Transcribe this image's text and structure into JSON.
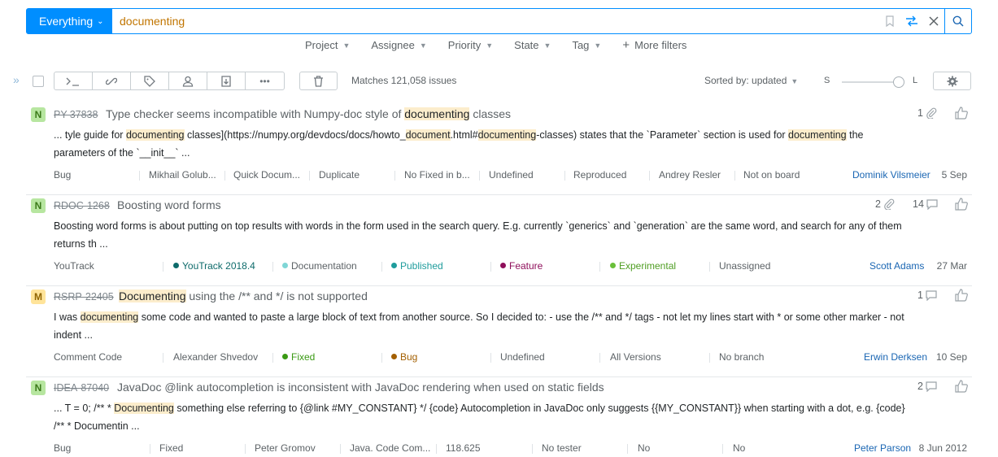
{
  "search": {
    "context": "Everything",
    "query": "documenting"
  },
  "filters": [
    "Project",
    "Assignee",
    "Priority",
    "State",
    "Tag"
  ],
  "more_filters": "More filters",
  "toolbar": {
    "matches": "Matches 121,058 issues",
    "sorted_by": "Sorted by: updated",
    "size_small": "S",
    "size_large": "L"
  },
  "issues": [
    {
      "priority": "N",
      "id": "PY-37838",
      "summary_pre": "Type checker seems incompatible with Numpy-doc style of ",
      "summary_hl": "documenting",
      "summary_post": " classes",
      "desc_parts": [
        "... tyle guide for ",
        "documenting",
        " classes](https://numpy.org/devdocs/docs/howto_",
        "document",
        ".html#",
        "documenting",
        "-classes) states that the `Parameter` section is used for ",
        "documenting",
        " the parameters of the `__init__` ..."
      ],
      "fields": [
        "Bug",
        "Mikhail Golub...",
        "Quick Docum...",
        "Duplicate",
        "No Fixed in b...",
        "Undefined",
        "Reproduced",
        "Andrey Resler",
        "Not on board"
      ],
      "assignee": "Dominik Vilsmeier",
      "date": "5 Sep",
      "attachments": "1",
      "comments": ""
    },
    {
      "priority": "N",
      "id": "RDOC-1268",
      "summary_pre": "Boosting word forms",
      "summary_hl": "",
      "summary_post": "",
      "desc_parts": [
        "Boosting word forms is about putting on top results with words in the form used in the search query. E.g. currently `generics` and `generation` are the same word, and search for any of them returns th ..."
      ],
      "fields": [
        "YouTrack",
        "YouTrack 2018.4",
        "Documentation",
        "Published",
        "Feature",
        "Experimental",
        "Unassigned"
      ],
      "field_colors": [
        "",
        "#0e6b6b",
        "#7fd6d6",
        "#1f9c9c",
        "#8f0f5b",
        "#6abf3a",
        ""
      ],
      "field_text_colors": [
        "",
        "#0e6b6b",
        "",
        "#1f9c9c",
        "#8f0f5b",
        "#4f9e23",
        ""
      ],
      "assignee": "Scott Adams",
      "date": "27 Mar",
      "attachments": "2",
      "comments": "14"
    },
    {
      "priority": "M",
      "id": "RSRP-22405",
      "summary_pre": "",
      "summary_hl": "Documenting",
      "summary_post": " using the /** and */ is not supported",
      "desc_parts": [
        "I was ",
        "documenting",
        " some code and wanted to paste a large block of text from another source. So I decided to: - use the /** and */ tags - not let my lines start with * or some other marker - not indent ..."
      ],
      "fields": [
        "Comment Code",
        "Alexander Shvedov",
        "Fixed",
        "Bug",
        "Undefined",
        "All Versions",
        "No branch"
      ],
      "field_colors": [
        "",
        "",
        "#3a9a14",
        "#a35f00",
        "",
        "",
        ""
      ],
      "field_text_colors": [
        "",
        "",
        "#3a9a14",
        "#a35f00",
        "",
        "",
        ""
      ],
      "assignee": "Erwin Derksen",
      "date": "10 Sep",
      "attachments": "",
      "comments": "1"
    },
    {
      "priority": "N",
      "id": "IDEA-87040",
      "summary_pre": "JavaDoc @link autocompletion is inconsistent with JavaDoc rendering when used on static fields",
      "summary_hl": "",
      "summary_post": "",
      "desc_parts": [
        "... T = 0; /** * ",
        "Documenting",
        " something else referring to {@link #MY_CONSTANT} */ {code} Autocompletion in JavaDoc only suggests {{MY_CONSTANT}} when starting with a dot, e.g. {code} /** * Documentin ..."
      ],
      "fields": [
        "Bug",
        "Fixed",
        "Peter Gromov",
        "Java. Code Com...",
        "118.625",
        "No tester",
        "No",
        "No"
      ],
      "assignee": "Peter Parson",
      "date": "8 Jun 2012",
      "attachments": "",
      "comments": "2"
    }
  ],
  "colors": {
    "accent": "#008eff",
    "highlight": "#fcedcc",
    "assignee": "#1a66b3"
  }
}
